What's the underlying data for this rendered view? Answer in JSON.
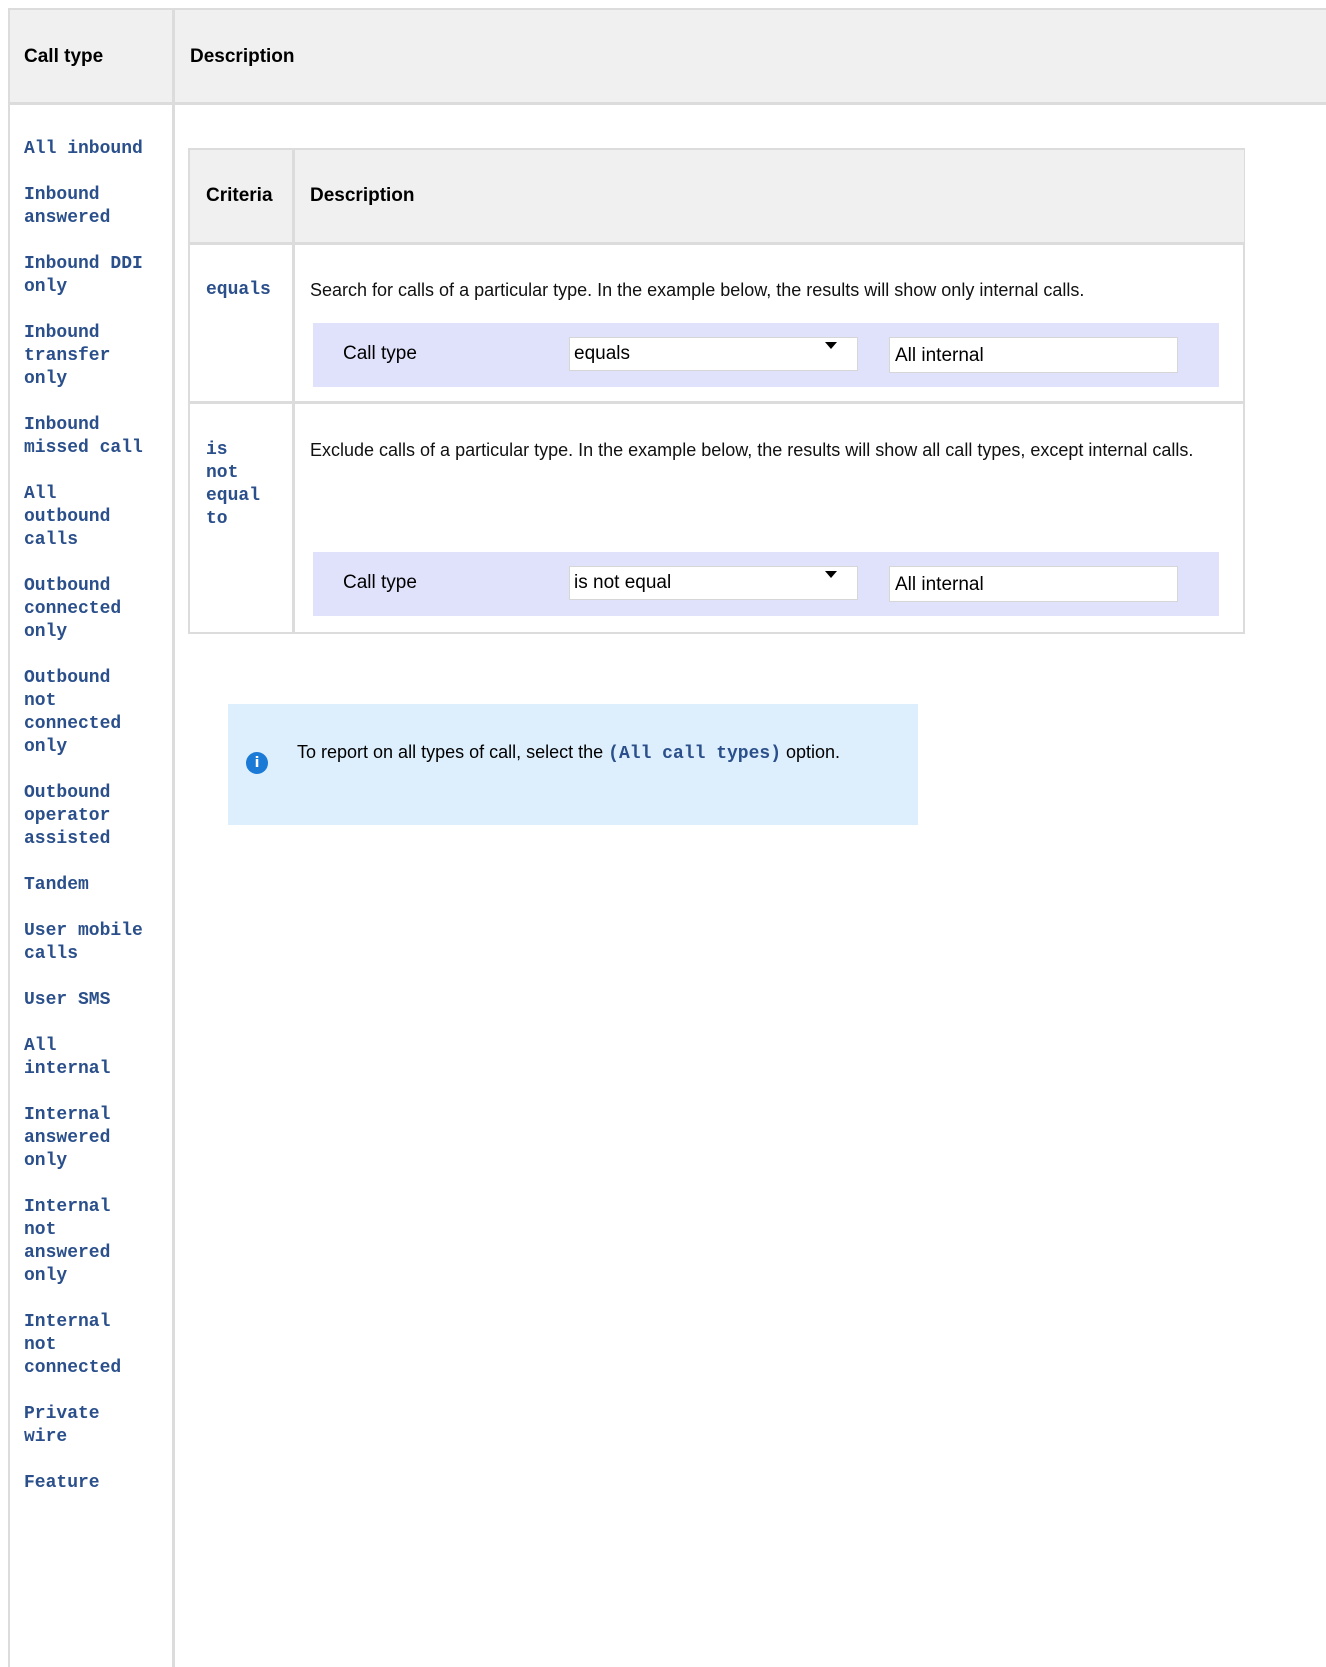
{
  "outer_table": {
    "headers": {
      "call_type": "Call type",
      "description": "Description"
    },
    "call_types": [
      "All inbound",
      "Inbound\nanswered",
      "Inbound DDI\nonly",
      "Inbound\ntransfer\nonly",
      "Inbound\nmissed call",
      "All\noutbound\ncalls",
      "Outbound\nconnected\nonly",
      "Outbound\nnot\nconnected\nonly",
      "Outbound\noperator\nassisted",
      "Tandem",
      "User mobile\ncalls",
      "User SMS",
      "All\ninternal",
      "Internal\nanswered\nonly",
      "Internal\nnot\nanswered\nonly",
      "Internal\nnot\nconnected",
      "Private\nwire",
      "Feature"
    ]
  },
  "inner_table": {
    "headers": {
      "criteria": "Criteria",
      "description": "Description"
    },
    "rows": [
      {
        "criteria": "equals",
        "description": "Search for calls of a particular type. In the example below, the results will show only internal calls.",
        "example": {
          "label": "Call type",
          "operator": "equals",
          "value": "All internal"
        }
      },
      {
        "criteria": "is\nnot\nequal\nto",
        "description": "Exclude calls of a particular type. In the example below, the results will show all call types, except internal calls.",
        "example": {
          "label": "Call type",
          "operator": "is not equal",
          "value": "All internal"
        }
      }
    ]
  },
  "info": {
    "icon": "info-icon",
    "text_before": "To report on all types of call, select the ",
    "code": "(All call types)",
    "text_after": " option."
  }
}
